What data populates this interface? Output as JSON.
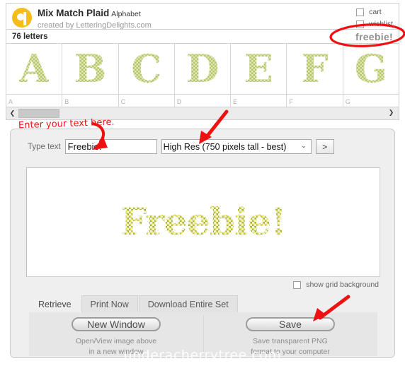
{
  "product": {
    "title": "Mix Match Plaid",
    "subtitle": "Alphabet",
    "credit": "created by LetteringDelights.com",
    "letters_count": "76 letters",
    "freebie_badge": "freebie!",
    "cart_label": "cart",
    "wishlist_label": "wishlist"
  },
  "letter_grid": {
    "cells": [
      {
        "glyph": "A",
        "tag": "A"
      },
      {
        "glyph": "B",
        "tag": "B"
      },
      {
        "glyph": "C",
        "tag": "C"
      },
      {
        "glyph": "D",
        "tag": "D"
      },
      {
        "glyph": "E",
        "tag": "E"
      },
      {
        "glyph": "F",
        "tag": "F"
      },
      {
        "glyph": "G",
        "tag": "G"
      }
    ],
    "scroll_left_icon": "❮",
    "scroll_right_icon": "❯"
  },
  "form": {
    "type_text_label": "Type text",
    "text_value": "Freebie!",
    "text_placeholder": "",
    "resolution_selected": "High Res (750 pixels tall - best)",
    "resolution_options": [
      "High Res (750 pixels tall - best)"
    ],
    "go_label": ">",
    "caret_icon": "⌄"
  },
  "preview": {
    "text": "Freebie!"
  },
  "options": {
    "show_grid_label": "show grid background"
  },
  "tabs": [
    {
      "label": "Retrieve",
      "active": true
    },
    {
      "label": "Print Now",
      "active": false
    },
    {
      "label": "Download Entire Set",
      "active": false
    }
  ],
  "actions": {
    "new_window_label": "New Window",
    "new_window_caption_line1": "Open/View image above",
    "new_window_caption_line2": "in a new window",
    "save_label": "Save",
    "save_caption_line1": "Save transparent PNG",
    "save_caption_line2": "format to your computer"
  },
  "watermark": "underacherrytree.com",
  "annotations": {
    "note_text": "Enter your text here.",
    "color": "#ee1111"
  },
  "colors": {
    "logo": "#f5bc1a",
    "panel_bg": "#efefef",
    "plaid_green": "#9fb551",
    "plaid_yellow": "#e9d94a",
    "annotation_red": "#ee1111"
  }
}
